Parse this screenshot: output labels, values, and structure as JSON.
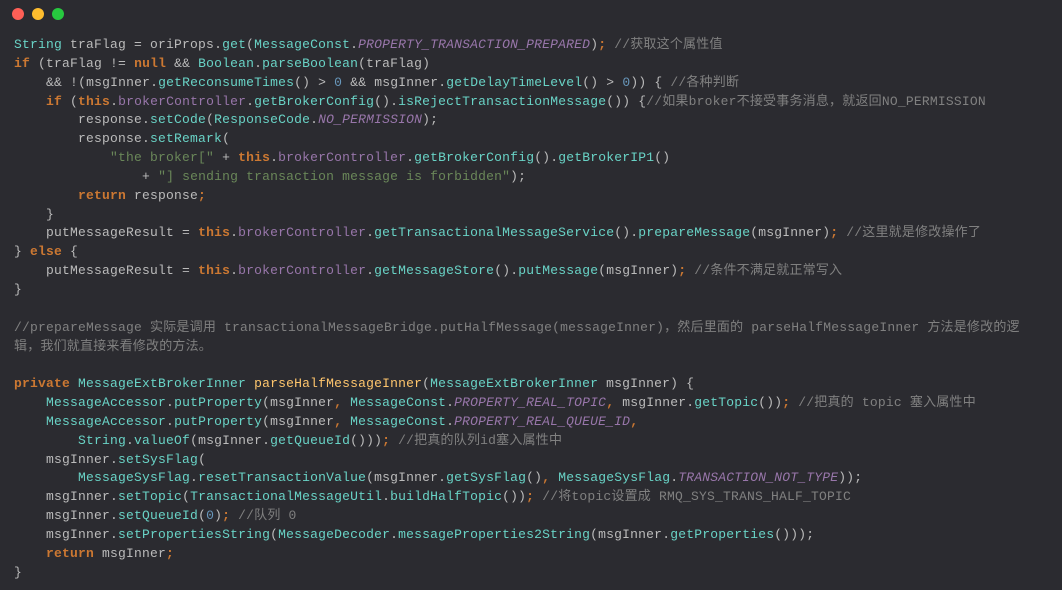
{
  "titlebar": {
    "dots": [
      "red",
      "yellow",
      "green"
    ]
  },
  "code": {
    "l1": {
      "t1": "String",
      "t2": " traFlag ",
      "t3": "=",
      "t4": " oriProps",
      "t5": ".",
      "t6": "get",
      "t7": "(",
      "t8": "MessageConst",
      "t9": ".",
      "t10": "PROPERTY_TRANSACTION_PREPARED",
      "t11": ")",
      "t12": ";",
      "t13": " //获取这个属性值"
    },
    "l2": {
      "t1": "if",
      "t2": " (traFlag ",
      "t3": "!=",
      "t4": " ",
      "t5": "null",
      "t6": " ",
      "t7": "&&",
      "t8": " ",
      "t9": "Boolean",
      "t10": ".",
      "t11": "parseBoolean",
      "t12": "(traFlag)"
    },
    "l3": {
      "indent": "    ",
      "t1": "&&",
      "t2": " ",
      "t3": "!",
      "t4": "(msgInner",
      "t5": ".",
      "t6": "getReconsumeTimes",
      "t7": "() ",
      "t8": ">",
      "t9": " ",
      "t10": "0",
      "t11": " ",
      "t12": "&&",
      "t13": " msgInner",
      "t14": ".",
      "t15": "getDelayTimeLevel",
      "t16": "() ",
      "t17": ">",
      "t18": " ",
      "t19": "0",
      "t20": ")) { ",
      "t21": "//各种判断"
    },
    "l4": {
      "indent": "    ",
      "t1": "if",
      "t2": " (",
      "t3": "this",
      "t4": ".",
      "t5": "brokerController",
      "t6": ".",
      "t7": "getBrokerConfig",
      "t8": "().",
      "t9": "isRejectTransactionMessage",
      "t10": "()) {",
      "t11": "//如果broker不接受事务消息，就返回NO_PERMISSION"
    },
    "l5": {
      "indent": "        ",
      "t1": "response",
      "t2": ".",
      "t3": "setCode",
      "t4": "(",
      "t5": "ResponseCode",
      "t6": ".",
      "t7": "NO_PERMISSION",
      "t8": ");"
    },
    "l6": {
      "indent": "        ",
      "t1": "response",
      "t2": ".",
      "t3": "setRemark",
      "t4": "("
    },
    "l7": {
      "indent": "            ",
      "t1": "\"the broker[\"",
      "t2": " ",
      "t3": "+",
      "t4": " ",
      "t5": "this",
      "t6": ".",
      "t7": "brokerController",
      "t8": ".",
      "t9": "getBrokerConfig",
      "t10": "().",
      "t11": "getBrokerIP1",
      "t12": "()"
    },
    "l8": {
      "indent": "                ",
      "t1": "+",
      "t2": " ",
      "t3": "\"] sending transaction message is forbidden\"",
      "t4": ");"
    },
    "l9": {
      "indent": "        ",
      "t1": "return",
      "t2": " response",
      "t3": ";"
    },
    "l10": {
      "indent": "    ",
      "t1": "}"
    },
    "l11": {
      "indent": "    ",
      "t1": "putMessageResult ",
      "t2": "=",
      "t3": " ",
      "t4": "this",
      "t5": ".",
      "t6": "brokerController",
      "t7": ".",
      "t8": "getTransactionalMessageService",
      "t9": "().",
      "t10": "prepareMessage",
      "t11": "(msgInner)",
      "t12": ";",
      "t13": " //这里就是修改操作了"
    },
    "l12": {
      "t1": "} ",
      "t2": "else",
      "t3": " {"
    },
    "l13": {
      "indent": "    ",
      "t1": "putMessageResult ",
      "t2": "=",
      "t3": " ",
      "t4": "this",
      "t5": ".",
      "t6": "brokerController",
      "t7": ".",
      "t8": "getMessageStore",
      "t9": "().",
      "t10": "putMessage",
      "t11": "(msgInner)",
      "t12": ";",
      "t13": " //条件不满足就正常写入"
    },
    "l14": {
      "t1": "}"
    },
    "blank1": "",
    "l15": {
      "t1": "//prepareMessage 实际是调用 transactionalMessageBridge.putHalfMessage(messageInner)，然后里面的 parseHalfMessageInner 方法是修改的逻辑，我们就直接来看修改的方法。"
    },
    "blank2": "",
    "l16": {
      "t1": "private",
      "t2": " ",
      "t3": "MessageExtBrokerInner",
      "t4": " ",
      "t5": "parseHalfMessageInner",
      "t6": "(",
      "t7": "MessageExtBrokerInner",
      "t8": " msgInner) {"
    },
    "l17": {
      "indent": "    ",
      "t1": "MessageAccessor",
      "t2": ".",
      "t3": "putProperty",
      "t4": "(msgInner",
      "t5": ",",
      "t6": " ",
      "t7": "MessageConst",
      "t8": ".",
      "t9": "PROPERTY_REAL_TOPIC",
      "t10": ",",
      "t11": " msgInner",
      "t12": ".",
      "t13": "getTopic",
      "t14": "())",
      "t15": ";",
      "t16": " //把真的 topic 塞入属性中"
    },
    "l18": {
      "indent": "    ",
      "t1": "MessageAccessor",
      "t2": ".",
      "t3": "putProperty",
      "t4": "(msgInner",
      "t5": ",",
      "t6": " ",
      "t7": "MessageConst",
      "t8": ".",
      "t9": "PROPERTY_REAL_QUEUE_ID",
      "t10": ","
    },
    "l19": {
      "indent": "        ",
      "t1": "String",
      "t2": ".",
      "t3": "valueOf",
      "t4": "(msgInner",
      "t5": ".",
      "t6": "getQueueId",
      "t7": "()))",
      "t8": ";",
      "t9": " //把真的队列id塞入属性中"
    },
    "l20": {
      "indent": "    ",
      "t1": "msgInner",
      "t2": ".",
      "t3": "setSysFlag",
      "t4": "("
    },
    "l21": {
      "indent": "        ",
      "t1": "MessageSysFlag",
      "t2": ".",
      "t3": "resetTransactionValue",
      "t4": "(msgInner",
      "t5": ".",
      "t6": "getSysFlag",
      "t7": "()",
      "t8": ",",
      "t9": " ",
      "t10": "MessageSysFlag",
      "t11": ".",
      "t12": "TRANSACTION_NOT_TYPE",
      "t13": "));"
    },
    "l22": {
      "indent": "    ",
      "t1": "msgInner",
      "t2": ".",
      "t3": "setTopic",
      "t4": "(",
      "t5": "TransactionalMessageUtil",
      "t6": ".",
      "t7": "buildHalfTopic",
      "t8": "())",
      "t9": ";",
      "t10": " //将topic设置成 RMQ_SYS_TRANS_HALF_TOPIC"
    },
    "l23": {
      "indent": "    ",
      "t1": "msgInner",
      "t2": ".",
      "t3": "setQueueId",
      "t4": "(",
      "t5": "0",
      "t6": ")",
      "t7": ";",
      "t8": " //队列 0"
    },
    "l24": {
      "indent": "    ",
      "t1": "msgInner",
      "t2": ".",
      "t3": "setPropertiesString",
      "t4": "(",
      "t5": "MessageDecoder",
      "t6": ".",
      "t7": "messageProperties2String",
      "t8": "(msgInner",
      "t9": ".",
      "t10": "getProperties",
      "t11": "()));"
    },
    "l25": {
      "indent": "    ",
      "t1": "return",
      "t2": " msgInner",
      "t3": ";"
    },
    "l26": {
      "t1": "}"
    }
  }
}
